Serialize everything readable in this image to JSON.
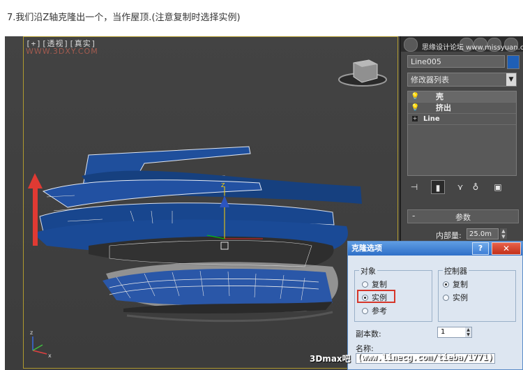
{
  "caption": "7.我们沿Z轴克隆出一个，当作屋顶.(注意复制时选择实例)",
  "viewport": {
    "label": "[+][透视][真实]",
    "site_watermark": "WWW.3DXY.COM",
    "bottom_watermark_prefix": "3Dmax吧",
    "bottom_watermark_url": "(www.linecg.com/tieba/1771)"
  },
  "panel": {
    "tab_caption": "思缘设计论坛 www.missyuan.com",
    "object_name": "Line005",
    "modifier_list": "修改器列表",
    "stack": [
      {
        "label": "壳",
        "icon": "lightbulb-icon"
      },
      {
        "label": "挤出",
        "icon": "lightbulb-icon"
      },
      {
        "label": "Line",
        "icon": "plus-icon"
      }
    ],
    "rollout_title": "参数",
    "inner_label": "内部量:",
    "inner_value": "25.0m",
    "color_swatch": "#1f5fb6"
  },
  "dialog": {
    "title": "克隆选项",
    "help": "?",
    "close": "✕",
    "object_group": "对象",
    "object_options": [
      "复制",
      "实例",
      "参考"
    ],
    "object_selected": "实例",
    "controller_group": "控制器",
    "controller_options": [
      "复制",
      "实例"
    ],
    "controller_selected": "复制",
    "copies_label": "副本数:",
    "copies_value": "1",
    "name_label": "名称:"
  }
}
